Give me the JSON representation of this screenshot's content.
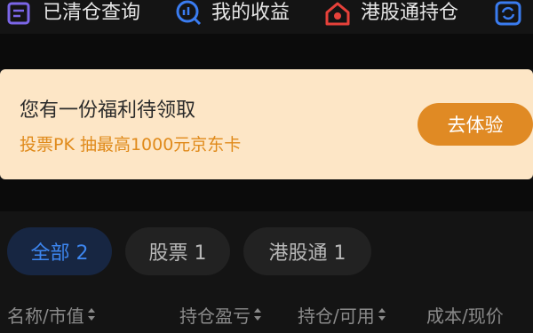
{
  "quick_nav": [
    {
      "label": "已清仓查询",
      "icon": "cleared-positions-icon"
    },
    {
      "label": "我的收益",
      "icon": "earnings-chart-icon"
    },
    {
      "label": "港股通持仓",
      "icon": "hk-house-icon"
    },
    {
      "label": "",
      "icon": "refresh-icon"
    }
  ],
  "promo": {
    "title": "您有一份福利待领取",
    "subtitle": "投票PK 抽最高1000元京东卡",
    "cta": "去体验"
  },
  "filters": [
    {
      "label": "全部 2",
      "active": true
    },
    {
      "label": "股票 1",
      "active": false
    },
    {
      "label": "港股通 1",
      "active": false
    }
  ],
  "columns": [
    "名称/市值",
    "持仓盈亏",
    "持仓/可用",
    "成本/现价"
  ],
  "colors": {
    "background": "#141414",
    "promo_bg": "#fde6c6",
    "promo_accent": "#e08a24",
    "active_chip_text": "#3d86f0",
    "nav_icon_purple": "#7b66e8",
    "nav_icon_blue": "#3a7cf0",
    "nav_icon_red": "#e6413a"
  }
}
